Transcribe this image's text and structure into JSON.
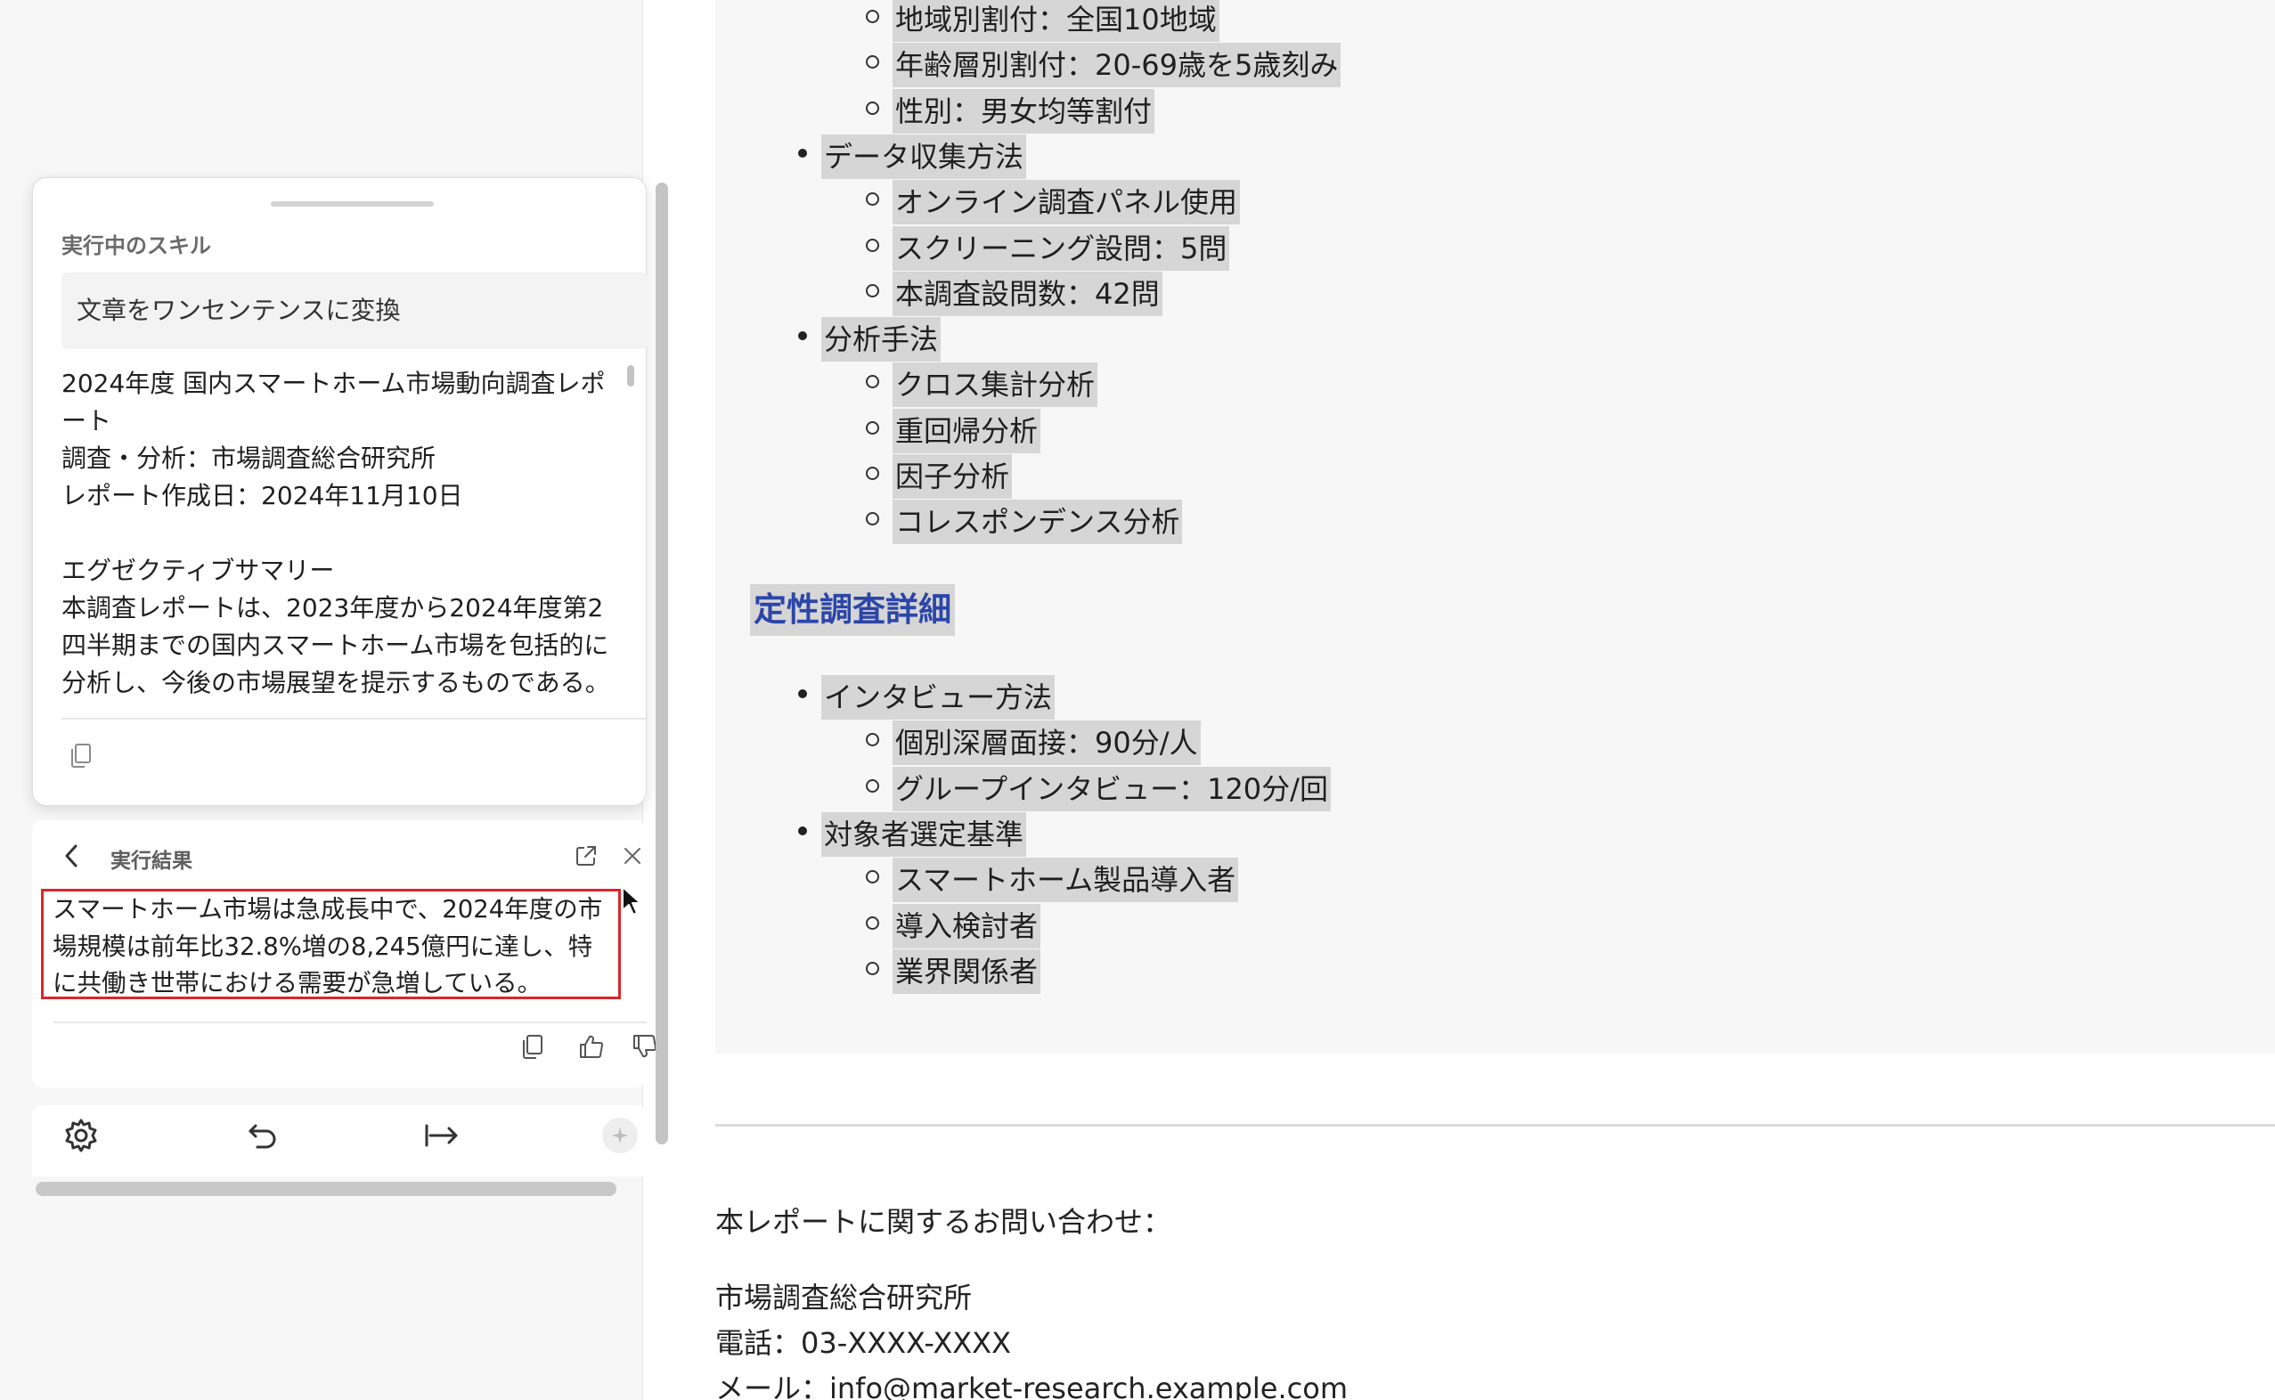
{
  "document": {
    "list1": [
      {
        "level": 2,
        "text": "地域別割付：全国10地域"
      },
      {
        "level": 2,
        "text": "年齢層別割付：20-69歳を5歳刻み"
      },
      {
        "level": 2,
        "text": "性別：男女均等割付"
      },
      {
        "level": 1,
        "text": "データ収集方法"
      },
      {
        "level": 2,
        "text": "オンライン調査パネル使用"
      },
      {
        "level": 2,
        "text": "スクリーニング設問：5問"
      },
      {
        "level": 2,
        "text": "本調査設問数：42問"
      },
      {
        "level": 1,
        "text": "分析手法"
      },
      {
        "level": 2,
        "text": "クロス集計分析"
      },
      {
        "level": 2,
        "text": "重回帰分析"
      },
      {
        "level": 2,
        "text": "因子分析"
      },
      {
        "level": 2,
        "text": "コレスポンデンス分析"
      }
    ],
    "heading": "定性調査詳細",
    "list2": [
      {
        "level": 1,
        "text": "インタビュー方法"
      },
      {
        "level": 2,
        "text": "個別深層面接：90分/人"
      },
      {
        "level": 2,
        "text": "グループインタビュー：120分/回"
      },
      {
        "level": 1,
        "text": "対象者選定基準"
      },
      {
        "level": 2,
        "text": "スマートホーム製品導入者"
      },
      {
        "level": 2,
        "text": "導入検討者"
      },
      {
        "level": 2,
        "text": "業界関係者"
      }
    ],
    "contact": {
      "intro": "本レポートに関するお問い合わせ：",
      "org": "市場調査総合研究所",
      "phone": "電話：03-XXXX-XXXX",
      "email": "メール：info@market-research.example.com"
    }
  },
  "skill_panel": {
    "running_title": "実行中のスキル",
    "skill_name": "文章をワンセンテンスに変換",
    "source_text": "2024年度 国内スマートホーム市場動向調査レポート\n調査・分析：市場調査総合研究所\nレポート作成日：2024年11月10日\n\nエグゼクティブサマリー\n本調査レポートは、2023年度から2024年度第2四半期までの国内スマートホーム市場を包括的に分析し、今後の市場展望を提示するものである。調",
    "result_title": "実行結果",
    "result_text": "スマートホーム市場は急成長中で、2024年度の市場規模は前年比32.8%増の8,245億円に達し、特に共働き世帯における需要が急増している。",
    "highlight_color": "#d9262c"
  }
}
